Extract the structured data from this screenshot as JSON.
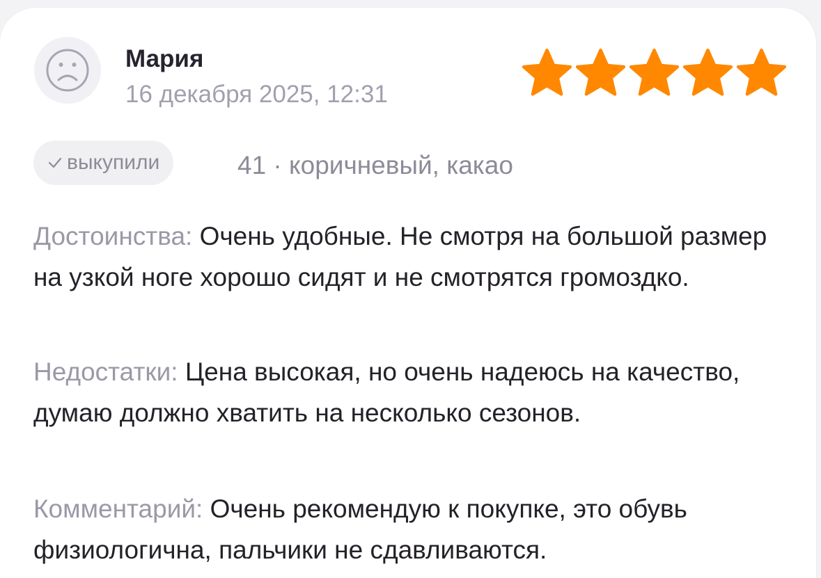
{
  "review": {
    "author": "Мария",
    "date": "16 декабря 2025, 12:31",
    "rating": 5,
    "rating_max": 5,
    "badge_label": "выкупили",
    "variant": "41 · коричневый, какао",
    "sections": {
      "pros": {
        "label": "Достоинства:",
        "text": "Очень удобные. Не смотря на большой размер на узкой ноге хорошо сидят и не смотрятся громоздко."
      },
      "cons": {
        "label": "Недостатки:",
        "text": "Цена высокая, но очень надеюсь на качество, думаю должно хватить на несколько сезонов."
      },
      "comment": {
        "label": "Комментарий:",
        "text": "Очень рекомендую к покупке, это обувь физиологична, пальчики не сдавливаются."
      }
    }
  },
  "icons": {
    "avatar": "sad-face-avatar-icon",
    "badge": "check-icon",
    "rating": "star-icon"
  },
  "colors": {
    "star": "#ff8800",
    "label": "#9c98a7",
    "text": "#242128",
    "muted": "#a39fae",
    "badge_bg": "#f0f0f3"
  }
}
